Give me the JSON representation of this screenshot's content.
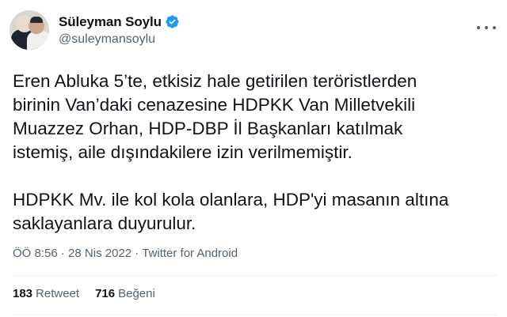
{
  "author": {
    "display_name": "Süleyman Soylu",
    "handle": "@suleymansoylu",
    "verified": true,
    "verified_color": "#1d9bf0"
  },
  "tweet": {
    "lines": [
      "Eren Abluka 5’te, etkisiz hale getirilen teröristlerden",
      "birinin Van’daki cenazesine HDPKK Van Milletvekili",
      "Muazzez Orhan, HDP-DBP İl Başkanları katılmak",
      "istemiş, aile dışındakilere izin verilmemiştir.",
      "",
      "HDPKK Mv. ile kol kola olanlara, HDP'yi masanın altına",
      "saklayanlara duyurulur."
    ],
    "time": "ÖÖ 8:56",
    "date": "28 Nis 2022",
    "source": "Twitter for Android",
    "separator": "·"
  },
  "stats": {
    "retweets_count": "183",
    "retweets_label": "Retweet",
    "likes_count": "716",
    "likes_label": "Beğeni"
  },
  "icons": {
    "more": "more-horizontal-icon",
    "verified": "verified-badge-icon"
  }
}
